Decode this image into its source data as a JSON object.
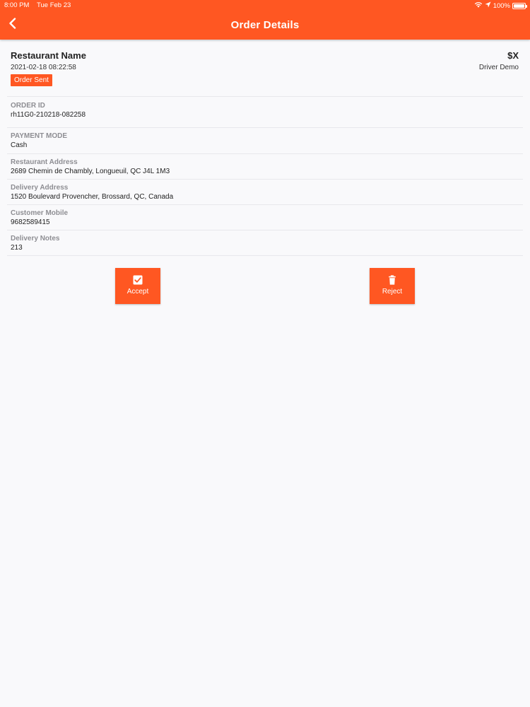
{
  "status_bar": {
    "time": "8:00 PM",
    "date": "Tue Feb 23",
    "battery": "100%",
    "battery_level": 1.0
  },
  "nav": {
    "title": "Order Details",
    "back_icon": "chevron-left-icon"
  },
  "order": {
    "restaurant_name": "Restaurant Name",
    "datetime": "2021-02-18 08:22:58",
    "status": "Order Sent",
    "price": "$X",
    "driver": "Driver Demo"
  },
  "fields": {
    "order_id": {
      "label": "ORDER ID",
      "value": "rh11G0-210218-082258"
    },
    "payment_mode": {
      "label": "PAYMENT MODE",
      "value": "Cash"
    },
    "restaurant_address": {
      "label": "Restaurant Address",
      "value": "2689 Chemin de Chambly, Longueuil, QC J4L 1M3"
    },
    "delivery_address": {
      "label": "Delivery Address",
      "value": "1520 Boulevard Provencher, Brossard, QC, Canada"
    },
    "customer_mobile": {
      "label": "Customer Mobile",
      "value": "9682589415"
    },
    "delivery_notes": {
      "label": "Delivery Notes",
      "value": "213"
    }
  },
  "actions": {
    "accept_label": "Accept",
    "accept_icon": "checkbox-checked-icon",
    "reject_label": "Reject",
    "reject_icon": "trash-icon"
  },
  "colors": {
    "accent": "#ff5722",
    "background": "#f9f9fb",
    "label_gray": "#8e8e93"
  }
}
